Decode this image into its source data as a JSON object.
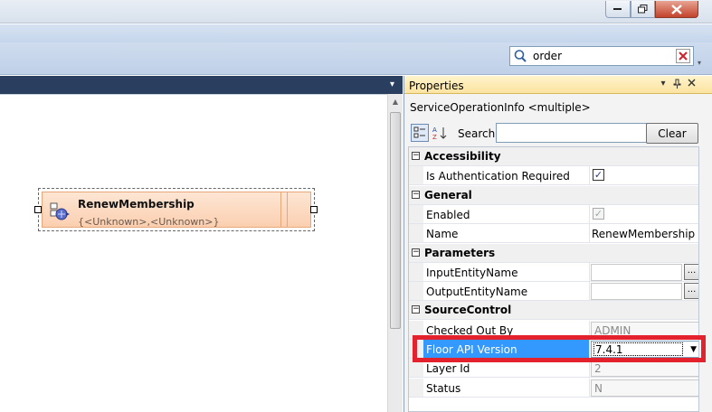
{
  "search": {
    "query": "order"
  },
  "properties": {
    "title": "Properties",
    "object": "ServiceOperationInfo <multiple>",
    "search_label": "Search:",
    "clear_label": "Clear",
    "categories": [
      {
        "name": "Accessibility",
        "rows": [
          {
            "label": "Is Authentication Required",
            "kind": "check",
            "checked": true
          }
        ]
      },
      {
        "name": "General",
        "rows": [
          {
            "label": "Enabled",
            "kind": "check-disabled",
            "checked": true
          },
          {
            "label": "Name",
            "kind": "text",
            "value": "RenewMembership"
          }
        ]
      },
      {
        "name": "Parameters",
        "rows": [
          {
            "label": "InputEntityName",
            "kind": "ellipsis",
            "value": ""
          },
          {
            "label": "OutputEntityName",
            "kind": "ellipsis",
            "value": ""
          }
        ]
      },
      {
        "name": "SourceControl",
        "rows": [
          {
            "label": "Checked Out By",
            "kind": "readonly",
            "value": "ADMIN"
          },
          {
            "label": "Floor API Version",
            "kind": "combo",
            "value": "7.4.1",
            "selected": true
          },
          {
            "label": "Layer Id",
            "kind": "readonly",
            "value": "2"
          },
          {
            "label": "Status",
            "kind": "readonly",
            "value": "N"
          }
        ]
      }
    ]
  },
  "activity": {
    "name": "RenewMembership",
    "signature": "{<Unknown>,<Unknown>}"
  },
  "colors": {
    "highlight": "#e3222e",
    "selection": "#3399ff",
    "panel_header": "#fbe3a0",
    "doc_header": "#2a3f5f"
  }
}
